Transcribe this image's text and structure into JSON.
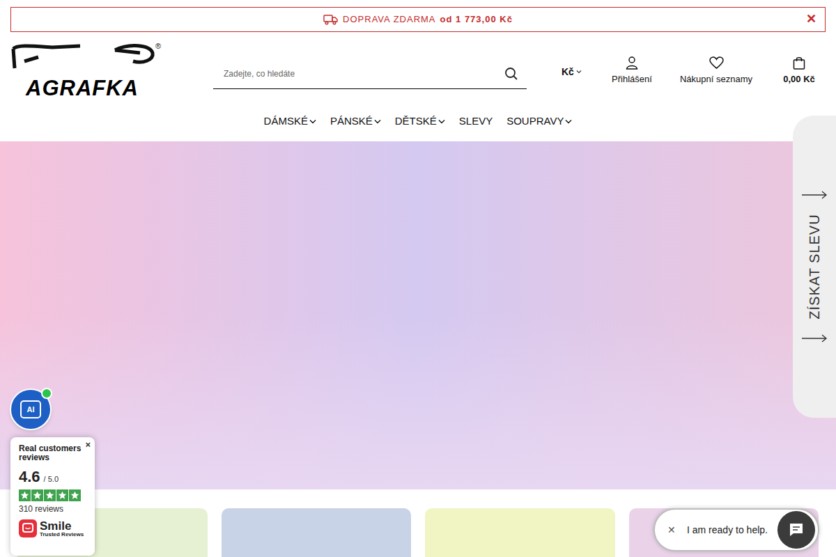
{
  "announcement": {
    "text": "DOPRAVA ZDARMA",
    "amount": "od 1 773,00 Kč",
    "close": "✕"
  },
  "logo": {
    "text": "AGRAFKA",
    "mark": "®"
  },
  "search": {
    "placeholder": "Zadejte, co hledáte"
  },
  "currency": {
    "label": "Kč"
  },
  "account": {
    "label": "Přihlášení"
  },
  "wishlist": {
    "label": "Nákupní seznamy"
  },
  "cart": {
    "label": "0,00 Kč"
  },
  "nav": [
    {
      "label": "DÁMSKÉ",
      "has_menu": true
    },
    {
      "label": "PÁNSKÉ",
      "has_menu": true
    },
    {
      "label": "DĚTSKÉ",
      "has_menu": true
    },
    {
      "label": "SLEVY",
      "has_menu": false
    },
    {
      "label": "SOUPRAVY",
      "has_menu": true
    }
  ],
  "discount_tab": {
    "label": "ZÍSKAT SLEVU"
  },
  "ai_button": {
    "label": "AI",
    "online": true
  },
  "reviews": {
    "title": "Real customers reviews",
    "score": "4.6",
    "max": "/ 5.0",
    "stars": 5,
    "count": "310 reviews",
    "brand": "Smile",
    "brand_sub": "Trusted Reviews",
    "close": "×"
  },
  "cards": [
    {
      "color": "#e6f0d2"
    },
    {
      "color": "#c8d3e8"
    },
    {
      "color": "#f1f5c4"
    },
    {
      "color": "#ead3e8"
    }
  ],
  "chat": {
    "close": "✕",
    "text": "I am ready to help."
  }
}
